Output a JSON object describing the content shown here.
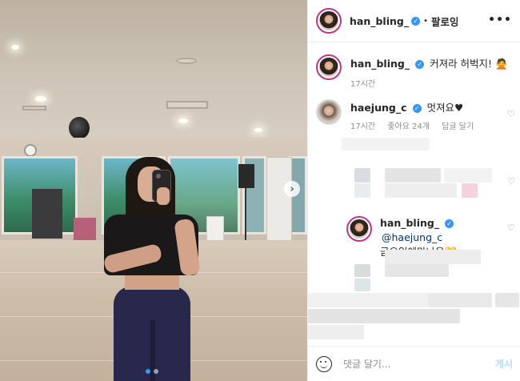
{
  "header": {
    "username": "han_bling_",
    "verified": true,
    "separator": "•",
    "follow_label": "팔로잉",
    "more_label": "•••"
  },
  "caption": {
    "username": "han_bling_",
    "text": "커져라 허벅지! 🙅",
    "time": "17시간"
  },
  "comments": [
    {
      "username": "haejung_c",
      "text": "멋져요♥",
      "time": "17시간",
      "likes": "좋아요 24개",
      "reply_label": "답글 달기"
    }
  ],
  "reply": {
    "username": "han_bling_",
    "mention": "@haejung_c",
    "text": "금요일에만나용💛"
  },
  "footer": {
    "placeholder": "댓글 달기...",
    "post_label": "게시"
  },
  "icons": {
    "next": "chevron-right-icon",
    "heart": "heart-icon",
    "emoji": "smile-icon",
    "verified": "verified-badge-icon",
    "more": "more-icon"
  },
  "colors": {
    "accent": "#3897f0",
    "post_disabled": "#b3dbff",
    "muted": "#8e8e8e"
  },
  "carousel": {
    "slides": 2,
    "active": 1
  }
}
